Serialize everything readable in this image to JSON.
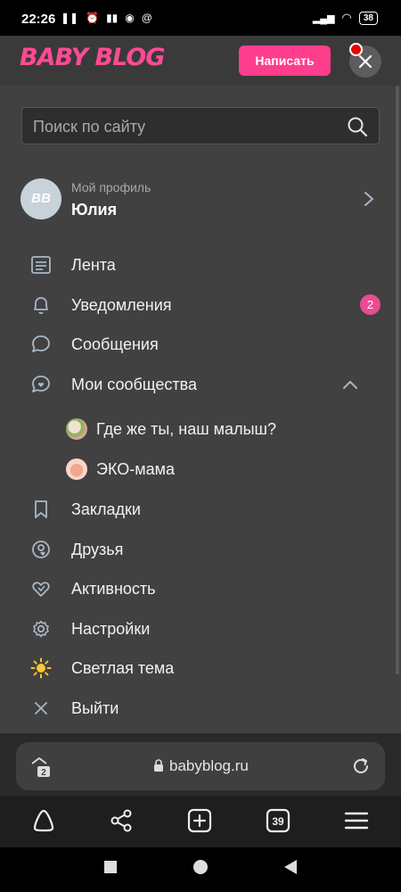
{
  "status_bar": {
    "time": "22:26",
    "battery": "38"
  },
  "header": {
    "logo": "BABY BLOG",
    "write_button": "Написать"
  },
  "search": {
    "placeholder": "Поиск по сайту"
  },
  "profile": {
    "avatar_text": "BB",
    "subtitle": "Мой профиль",
    "name": "Юлия"
  },
  "menu": {
    "items": [
      {
        "label": "Лента",
        "icon": "feed-icon"
      },
      {
        "label": "Уведомления",
        "icon": "bell-icon",
        "badge": "2"
      },
      {
        "label": "Сообщения",
        "icon": "message-icon"
      },
      {
        "label": "Мои сообщества",
        "icon": "communities-icon"
      },
      {
        "label": "Закладки",
        "icon": "bookmark-icon"
      },
      {
        "label": "Друзья",
        "icon": "friends-icon"
      },
      {
        "label": "Активность",
        "icon": "heart-icon"
      },
      {
        "label": "Настройки",
        "icon": "gear-icon"
      },
      {
        "label": "Светлая тема",
        "icon": "sun-icon"
      },
      {
        "label": "Выйти",
        "icon": "close-icon"
      }
    ],
    "communities": [
      {
        "label": "Где же ты, наш малыш?"
      },
      {
        "label": "ЭКО-мама"
      }
    ]
  },
  "browser": {
    "url": "babyblog.ru",
    "tab_count": "2",
    "tabs_total": "39"
  },
  "colors": {
    "accent": "#ff3d8d",
    "badge": "#e94c8f",
    "menu_bg": "#414141",
    "icon": "#a9b7c6"
  }
}
